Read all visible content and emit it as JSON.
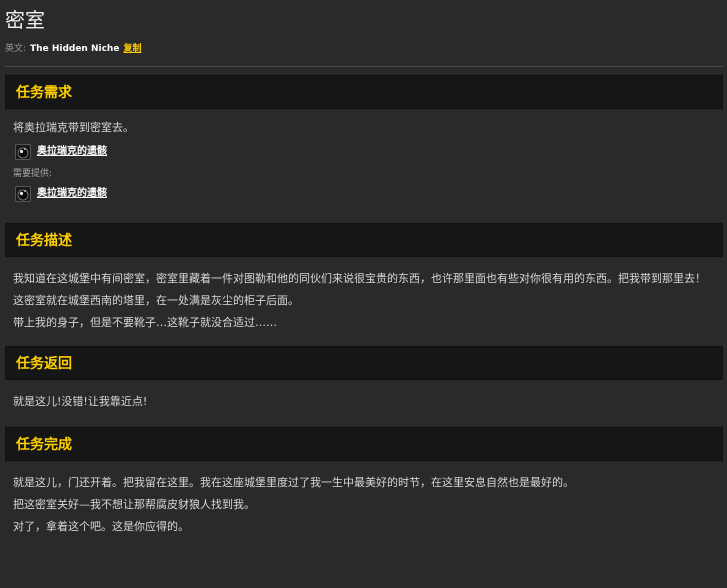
{
  "page": {
    "title": "密室",
    "english_label": "英文:",
    "english_name": "The Hidden Niche",
    "copy_label": "复制"
  },
  "sections": {
    "requirements": {
      "header": "任务需求",
      "text": "将奥拉瑞克带到密室去。",
      "item_name": "奥拉瑞克的遗骸",
      "provided_label": "需要提供:",
      "provided_item_name": "奥拉瑞克的遗骸"
    },
    "description": {
      "header": "任务描述",
      "lines": [
        "我知道在这城堡中有间密室，密室里藏着一件对图勒和他的同伙们来说很宝贵的东西，也许那里面也有些对你很有用的东西。把我带到那里去！",
        "这密室就在城堡西南的塔里，在一处满是灰尘的柜子后面。",
        "带上我的身子，但是不要靴子…这靴子就没合适过……"
      ]
    },
    "progress": {
      "header": "任务返回",
      "text": "就是这儿!没错!让我靠近点!"
    },
    "completion": {
      "header": "任务完成",
      "lines": [
        "就是这儿，门还开着。把我留在这里。我在这座城堡里度过了我一生中最美好的时节，在这里安息自然也是最好的。",
        "把这密室关好—我不想让那帮腐皮豺狼人找到我。",
        "对了，拿着这个吧。这是你应得的。"
      ]
    }
  },
  "colors": {
    "background": "#2a2a2a",
    "header_bg": "#161616",
    "accent": "#ffd100",
    "link": "#ffcc00"
  },
  "icons": {
    "item_icon": "skull-orb-icon"
  }
}
